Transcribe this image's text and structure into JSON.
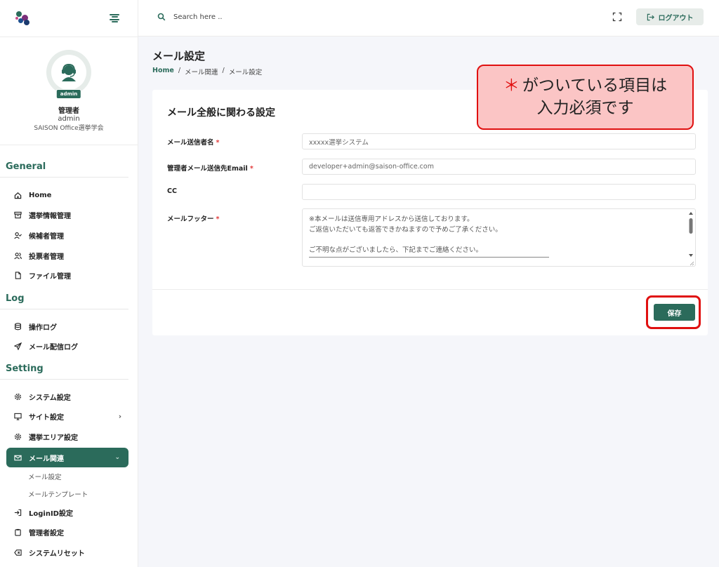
{
  "header": {
    "search_placeholder": "Search here ..",
    "logout_label": "ログアウト"
  },
  "profile": {
    "badge": "admin",
    "role": "管理者",
    "username": "admin",
    "organization": "SAISON Office選挙学会"
  },
  "sidebar": {
    "sections": {
      "general": "General",
      "log": "Log",
      "setting": "Setting"
    },
    "general_items": [
      "Home",
      "選挙情報管理",
      "候補者管理",
      "投票者管理",
      "ファイル管理"
    ],
    "log_items": [
      "操作ログ",
      "メール配信ログ"
    ],
    "setting_items": [
      "システム設定",
      "サイト設定",
      "選挙エリア設定"
    ],
    "active_item": "メール関連",
    "sub_items": [
      "メール設定",
      "メールテンプレート"
    ],
    "bottom_items": [
      "LoginID設定",
      "管理者設定",
      "システムリセット"
    ]
  },
  "main": {
    "page_title": "メール設定",
    "breadcrumb": [
      "Home",
      "/",
      "メール関連",
      "/",
      "メール設定"
    ],
    "card_title": "メール全般に関わる設定",
    "fields": {
      "sender_name": {
        "label": "メール送信者名",
        "required": "*",
        "value": "xxxxx選挙システム"
      },
      "admin_email": {
        "label": "管理者メール送信先Email",
        "required": "*",
        "value": "developer+admin@saison-office.com"
      },
      "cc": {
        "label": "CC",
        "value": ""
      },
      "footer": {
        "label": "メールフッター",
        "required": "*",
        "lines": [
          "※本メールは送信専用アドレスから送信しております。",
          "ご返信いただいても返答できかねますので予めご了承ください。",
          "",
          "ご不明な点がございましたら、下記までご連絡ください。"
        ]
      }
    },
    "save_label": "保存"
  },
  "callout": {
    "asterisk": "＊",
    "line1": "がついている項目は",
    "line2": "入力必須です"
  },
  "colors": {
    "brand": "#2b6b5b",
    "required": "#e23b3b",
    "highlight": "#e01010",
    "callout_bg": "#fbc5c5"
  }
}
